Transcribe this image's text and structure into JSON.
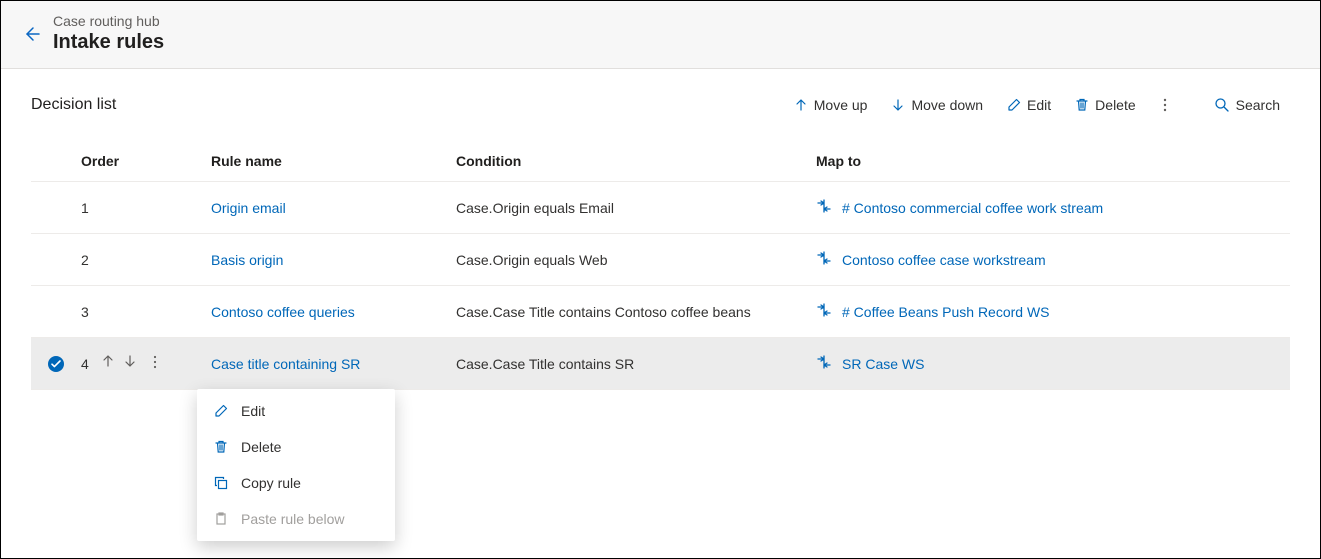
{
  "header": {
    "breadcrumb": "Case routing hub",
    "title": "Intake rules"
  },
  "toolbar": {
    "section_title": "Decision list",
    "actions": {
      "move_up": "Move up",
      "move_down": "Move down",
      "edit": "Edit",
      "delete": "Delete",
      "search": "Search"
    }
  },
  "table": {
    "columns": {
      "order": "Order",
      "rule_name": "Rule name",
      "condition": "Condition",
      "map_to": "Map to"
    },
    "rows": [
      {
        "order": "1",
        "rule_name": "Origin email",
        "condition": "Case.Origin equals Email",
        "map_to": "# Contoso commercial coffee work stream",
        "selected": false
      },
      {
        "order": "2",
        "rule_name": "Basis origin",
        "condition": "Case.Origin equals Web",
        "map_to": "Contoso coffee case workstream",
        "selected": false
      },
      {
        "order": "3",
        "rule_name": "Contoso coffee queries",
        "condition": "Case.Case Title contains Contoso coffee beans",
        "map_to": "# Coffee Beans Push Record WS",
        "selected": false
      },
      {
        "order": "4",
        "rule_name": "Case title containing SR",
        "condition": "Case.Case Title contains SR",
        "map_to": "SR Case WS",
        "selected": true
      }
    ]
  },
  "context_menu": {
    "edit": "Edit",
    "delete": "Delete",
    "copy": "Copy rule",
    "paste_below": "Paste rule below"
  }
}
